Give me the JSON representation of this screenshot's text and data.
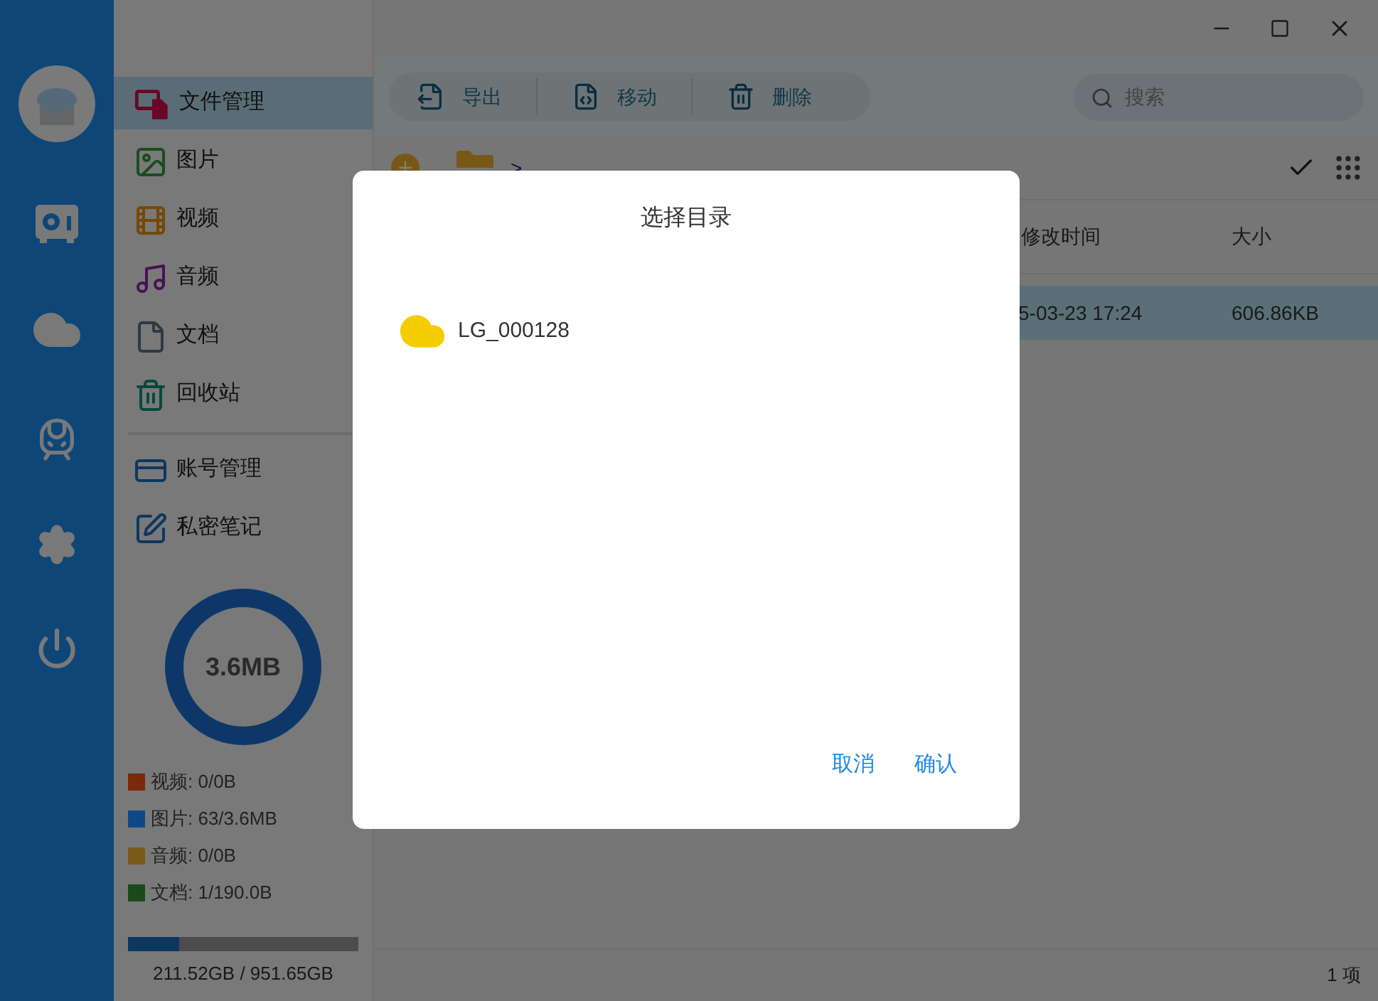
{
  "sidebar": {
    "groups": [
      [
        {
          "label": "文件管理",
          "selected": true
        },
        {
          "label": "图片",
          "selected": false
        },
        {
          "label": "视频",
          "selected": false
        },
        {
          "label": "音频",
          "selected": false
        },
        {
          "label": "文档",
          "selected": false
        },
        {
          "label": "回收站",
          "selected": false
        }
      ],
      [
        {
          "label": "账号管理",
          "selected": false
        },
        {
          "label": "私密笔记",
          "selected": false
        }
      ]
    ]
  },
  "storage": {
    "total": "3.6MB",
    "legend": [
      {
        "label": "视频: 0/0B",
        "color": "#7a2a0a"
      },
      {
        "label": "图片: 63/3.6MB",
        "color": "#0d4a85"
      },
      {
        "label": "音频: 0/0B",
        "color": "#7a5a18"
      },
      {
        "label": "文档: 1/190.0B",
        "color": "#1a4a1a"
      }
    ],
    "disk": {
      "level": 0.22,
      "text": "211.52GB / 951.65GB"
    }
  },
  "toolbar": {
    "buttons": [
      "导出",
      "移动",
      "删除"
    ],
    "search": {
      "placeholder": "搜索"
    }
  },
  "breadcrumb": ">",
  "table": {
    "columns": [
      "修改时间",
      "大小"
    ],
    "rows": [
      {
        "cells": [
          "5-03-23 17:24",
          "606.86KB"
        ],
        "selected": true
      }
    ]
  },
  "status_bar": "1 项",
  "dialog": {
    "title": "选择目录",
    "items": [
      {
        "label": "LG_000128"
      }
    ],
    "buttons": [
      "取消",
      "确认"
    ]
  }
}
